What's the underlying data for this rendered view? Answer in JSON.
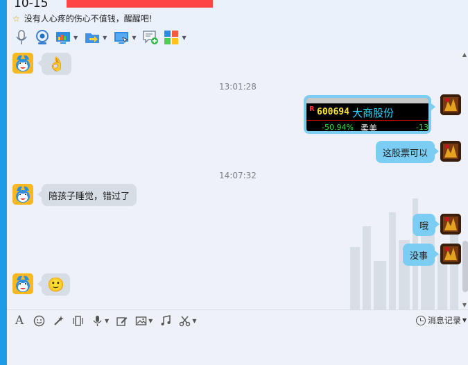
{
  "header": {
    "title": "10-15",
    "signature": "没有人心疼的伤心不值钱，醒醒吧!"
  },
  "toolbar": {
    "icons": [
      "microphone-icon",
      "webcam-icon",
      "remote-desktop-icon",
      "file-transfer-icon",
      "screen-share-icon",
      "message-add-icon",
      "apps-icon"
    ]
  },
  "chat": {
    "timestamps": [
      "13:01:28",
      "14:07:32"
    ],
    "messages": [
      {
        "side": "left",
        "type": "emoji",
        "content": "👌"
      },
      {
        "side": "right",
        "type": "stock-image"
      },
      {
        "side": "right",
        "type": "text",
        "content": "这股票可以"
      },
      {
        "side": "left",
        "type": "text",
        "content": "陪孩子睡觉，错过了"
      },
      {
        "side": "right",
        "type": "text",
        "content": "哦"
      },
      {
        "side": "right",
        "type": "text",
        "content": "没事"
      },
      {
        "side": "left",
        "type": "emoji",
        "content": "🙂"
      }
    ],
    "stock": {
      "flag": "R",
      "code": "600694",
      "name": "大商股份",
      "change_pct": "-50.94%",
      "extra": "柔美",
      "neg": "-13"
    }
  },
  "input_toolbar": {
    "history_label": "消息记录"
  },
  "colors": {
    "accent_blue": "#1d9be6",
    "bubble_right": "#7ccdf3",
    "bubble_left": "#d7dde5"
  }
}
